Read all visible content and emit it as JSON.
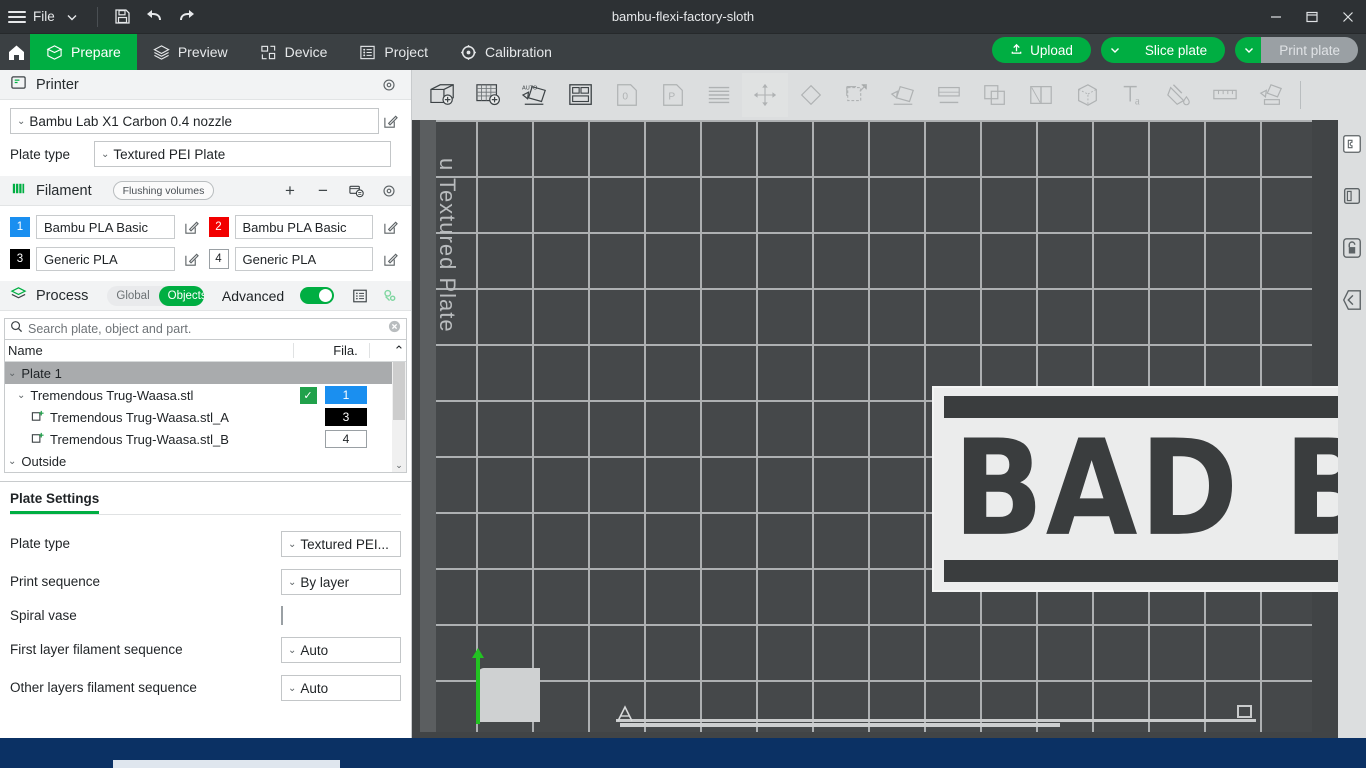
{
  "window": {
    "title": "bambu-flexi-factory-sloth",
    "file_menu": "File",
    "menu_caret": "chevron-down",
    "controls": {
      "minimize": "−",
      "maximize": "▢",
      "close": "✕"
    }
  },
  "toolbar": {
    "save": "save-icon",
    "undo": "undo-icon",
    "redo": "redo-icon"
  },
  "tabs": [
    {
      "label": "Prepare",
      "icon": "box-icon",
      "active": true
    },
    {
      "label": "Preview",
      "icon": "layers-icon",
      "active": false
    },
    {
      "label": "Device",
      "icon": "device-icon",
      "active": false
    },
    {
      "label": "Project",
      "icon": "list-icon",
      "active": false
    },
    {
      "label": "Calibration",
      "icon": "target-icon",
      "active": false
    }
  ],
  "actions": {
    "upload": "Upload",
    "slice_plate": "Slice plate",
    "print_plate": "Print plate",
    "caret": "⌄"
  },
  "printer": {
    "section_title": "Printer",
    "gear": "gear-icon",
    "preset": "Bambu Lab X1 Carbon 0.4 nozzle",
    "plate_type_label": "Plate type",
    "plate_type_value": "Textured PEI Plate"
  },
  "filament": {
    "section_title": "Filament",
    "flushing_volumes": "Flushing volumes",
    "add": "+",
    "remove": "−",
    "slots": [
      {
        "index": "1",
        "name": "Bambu PLA Basic",
        "color": "#1a8ff0",
        "text_color": "#ffffff"
      },
      {
        "index": "2",
        "name": "Bambu PLA Basic",
        "color": "#f20000",
        "text_color": "#ffffff"
      },
      {
        "index": "3",
        "name": "Generic PLA",
        "color": "#000000",
        "text_color": "#ffffff"
      },
      {
        "index": "4",
        "name": "Generic PLA",
        "color": "#ffffff",
        "text_color": "#1f2326"
      }
    ]
  },
  "process": {
    "section_title": "Process",
    "scope_global": "Global",
    "scope_objects": "Objects",
    "scope_selected": "Objects",
    "advanced_label": "Advanced",
    "advanced_on": true
  },
  "search": {
    "placeholder": "Search plate, object and part.",
    "value": "",
    "icon": "search-icon",
    "clear": "clear-icon"
  },
  "object_tree": {
    "columns": {
      "name": "Name",
      "fila": "Fila."
    },
    "rows": [
      {
        "label": "Plate 1",
        "depth": 0,
        "expander": "⌄",
        "selected": true,
        "check": "",
        "fila": "",
        "fila_bg": "",
        "fila_fg": ""
      },
      {
        "label": "Tremendous Trug-Waasa.stl",
        "depth": 1,
        "expander": "⌄",
        "selected": false,
        "check": "✓",
        "fila": "1",
        "fila_bg": "#1a8ff0",
        "fila_fg": "#ffffff"
      },
      {
        "label": "Tremendous Trug-Waasa.stl_A",
        "depth": 2,
        "expander": "",
        "selected": false,
        "check": "",
        "fila": "3",
        "fila_bg": "#000000",
        "fila_fg": "#ffffff"
      },
      {
        "label": "Tremendous Trug-Waasa.stl_B",
        "depth": 2,
        "expander": "",
        "selected": false,
        "check": "",
        "fila": "4",
        "fila_bg": "#ffffff",
        "fila_fg": "#1f2326"
      },
      {
        "label": "Outside",
        "depth": 0,
        "expander": "⌄",
        "selected": false,
        "check": "",
        "fila": "",
        "fila_bg": "",
        "fila_fg": ""
      }
    ],
    "scroll_up": "⌃",
    "scroll_down": "⌄"
  },
  "plate_settings": {
    "tab_label": "Plate Settings",
    "rows": [
      {
        "label": "Plate type",
        "control": "combo",
        "value": "Textured PEI..."
      },
      {
        "label": "Print sequence",
        "control": "combo",
        "value": "By layer"
      },
      {
        "label": "Spiral vase",
        "control": "checkbox",
        "value": "",
        "checked": false
      },
      {
        "label": "First layer filament sequence",
        "control": "combo",
        "value": "Auto"
      },
      {
        "label": "Other layers filament sequence",
        "control": "combo",
        "value": "Auto"
      }
    ]
  },
  "viewport": {
    "plate_label": "u Textured Plate",
    "model_text": "BAD BOYS",
    "tools": [
      {
        "name": "add-object-icon",
        "enabled": true
      },
      {
        "name": "add-plate-icon",
        "enabled": true
      },
      {
        "name": "auto-arrange-icon",
        "enabled": true
      },
      {
        "name": "layout-icon",
        "enabled": true
      },
      {
        "name": "orient-0-icon",
        "enabled": false
      },
      {
        "name": "orient-p-icon",
        "enabled": false
      },
      {
        "name": "layers-view-icon",
        "enabled": false
      },
      {
        "name": "move-icon",
        "enabled": false
      },
      {
        "name": "rotate-icon",
        "enabled": false
      },
      {
        "name": "scale-icon",
        "enabled": false
      },
      {
        "name": "mirror-icon",
        "enabled": false
      },
      {
        "name": "place-on-face-icon",
        "enabled": false
      },
      {
        "name": "cut-icon",
        "enabled": false
      },
      {
        "name": "support-paint-icon",
        "enabled": false
      },
      {
        "name": "color-paint-icon",
        "enabled": false
      },
      {
        "name": "seam-icon",
        "enabled": false
      },
      {
        "name": "text-icon",
        "enabled": false
      },
      {
        "name": "fill-color-icon",
        "enabled": false
      },
      {
        "name": "measure-icon",
        "enabled": false
      },
      {
        "name": "assembly-icon",
        "enabled": false
      }
    ],
    "side_tools": [
      {
        "name": "puzzle-icon"
      },
      {
        "name": "panel-icon"
      },
      {
        "name": "lock-icon"
      },
      {
        "name": "collapse-icon"
      }
    ]
  },
  "colors": {
    "accent_green": "#00ae42",
    "titlebar": "#2d3134",
    "tabbar": "#3b4043",
    "bed": "#45484a",
    "desktop": "#0b3164"
  }
}
